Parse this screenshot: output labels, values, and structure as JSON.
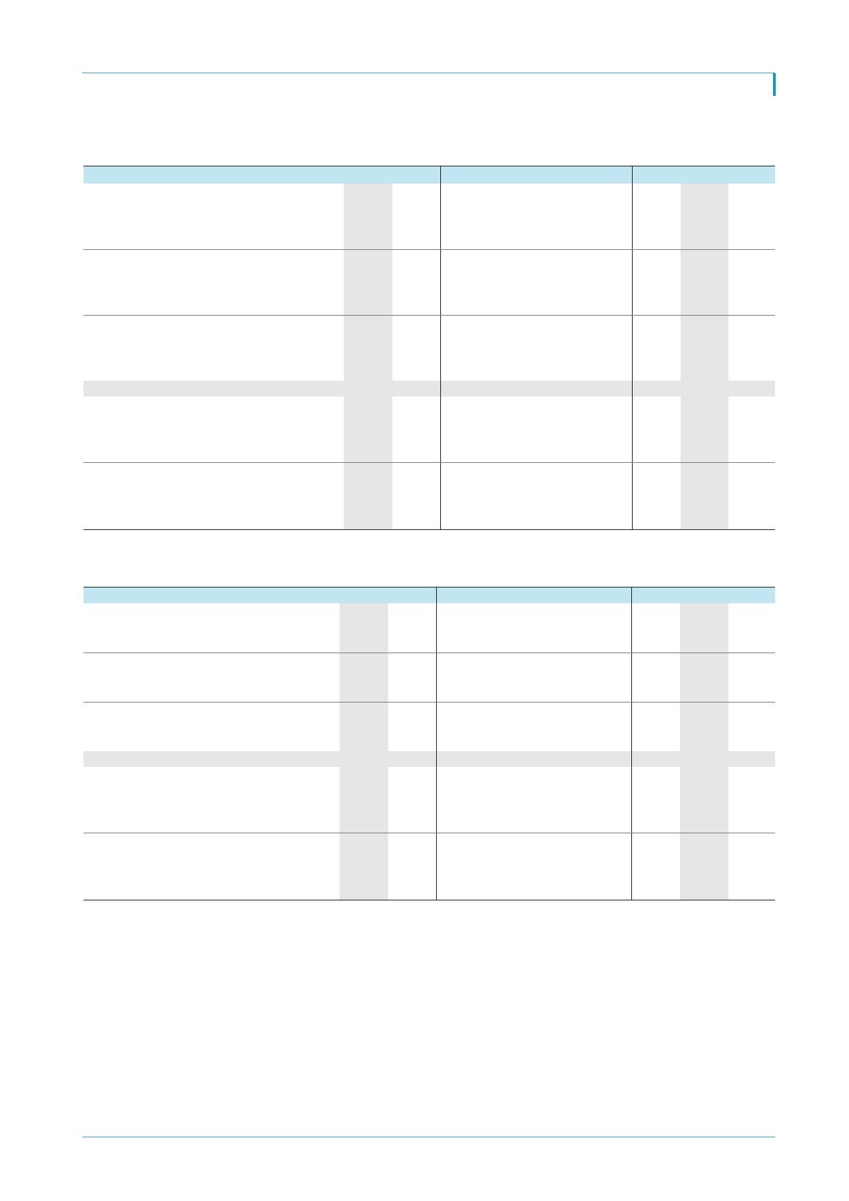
{
  "colors": {
    "accent": "#3ba3c9",
    "tab_marker": "#1896c1",
    "table_header": "#c2e6f1",
    "shade": "#e6e6e6",
    "row_rule": "#7a7a7a",
    "table_border": "#1a1a1a"
  },
  "tables": [
    {
      "header_cells": 3,
      "body_rows": 5,
      "shaded_separator_after_row": 3
    },
    {
      "header_cells": 3,
      "body_rows": 5,
      "shaded_separator_after_row": 3
    }
  ]
}
